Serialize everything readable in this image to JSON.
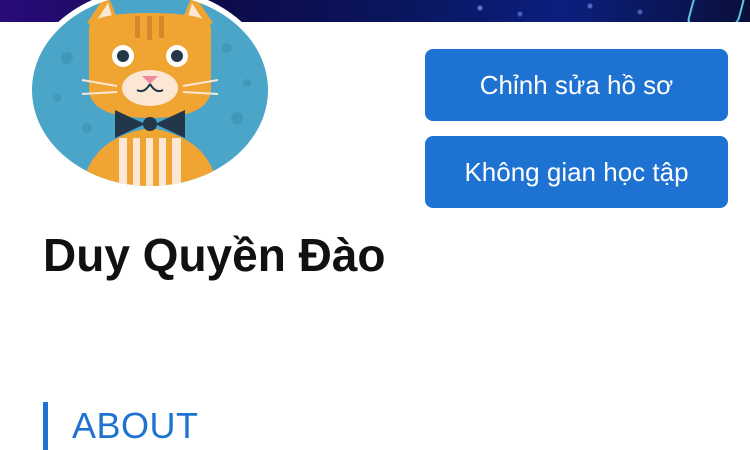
{
  "profile": {
    "name": "Duy Quyền Đào",
    "avatar_icon": "cat-with-bowtie-avatar"
  },
  "actions": {
    "edit_profile_label": "Chỉnh sửa hồ sơ",
    "learning_space_label": "Không gian học tập"
  },
  "about": {
    "heading": "ABOUT"
  },
  "colors": {
    "accent": "#1e72d1",
    "text": "#111111",
    "avatar_bg": "#4aa5c8",
    "cat_orange": "#f0a431",
    "bowtie": "#22374a"
  }
}
